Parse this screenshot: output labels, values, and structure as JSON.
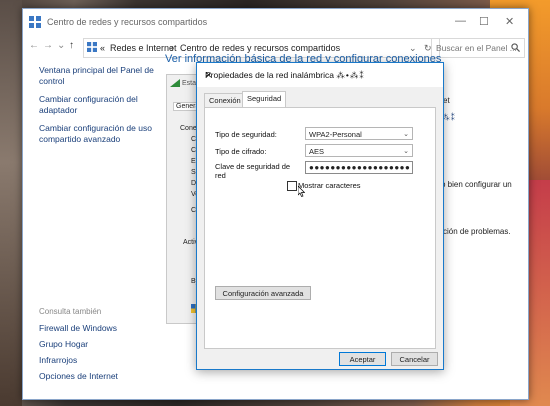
{
  "window": {
    "title": "Centro de redes y recursos compartidos",
    "controls": {
      "minimize": "—",
      "maximize": "☐",
      "close": "✕"
    }
  },
  "address": {
    "back": "←",
    "forward": "→",
    "recent": "⌄",
    "up": "↑",
    "crumbs": [
      "«",
      "Redes e Internet",
      "›",
      "Centro de redes y recursos compartidos"
    ],
    "dropdown": "⌄",
    "refresh": "↻",
    "search_placeholder": "Buscar en el Panel ..."
  },
  "sidebar": {
    "links": [
      "Ventana principal del Panel de control",
      "Cambiar configuración del adaptador",
      "Cambiar configuración de uso compartido avanzado"
    ],
    "see_also_title": "Consulta también",
    "see_also": [
      "Firewall de Windows",
      "Grupo Hogar",
      "Infrarrojos",
      "Opciones de Internet"
    ]
  },
  "main": {
    "title": "Ver información básica de la red y configurar conexiones",
    "frag_net": "et",
    "frag_config": "o bien configurar un",
    "frag_problems": "ción de problemas."
  },
  "status_window": {
    "title": "Esta",
    "tab": "Genera",
    "frags": [
      "Conex",
      "Co",
      "Co",
      "Est",
      "SS",
      "Du",
      "Ve",
      "Ca",
      "Activ",
      "By"
    ]
  },
  "dialog": {
    "title": "Propiedades de la red inalámbrica",
    "close": "✕",
    "tabs": [
      "Conexión",
      "Seguridad"
    ],
    "security_type_label": "Tipo de seguridad:",
    "security_type_value": "WPA2-Personal",
    "cipher_label": "Tipo de cifrado:",
    "cipher_value": "AES",
    "key_label": "Clave de seguridad de red",
    "key_value": "●●●●●●●●●●●●●●●●●●●",
    "show_chars_label": "Mostrar caracteres",
    "show_chars_checked": false,
    "advanced_button": "Configuración avanzada",
    "ok_button": "Aceptar",
    "cancel_button": "Cancelar"
  },
  "colors": {
    "link": "#1a3f7a",
    "title": "#1b5fa8",
    "accent": "#0078d7"
  }
}
